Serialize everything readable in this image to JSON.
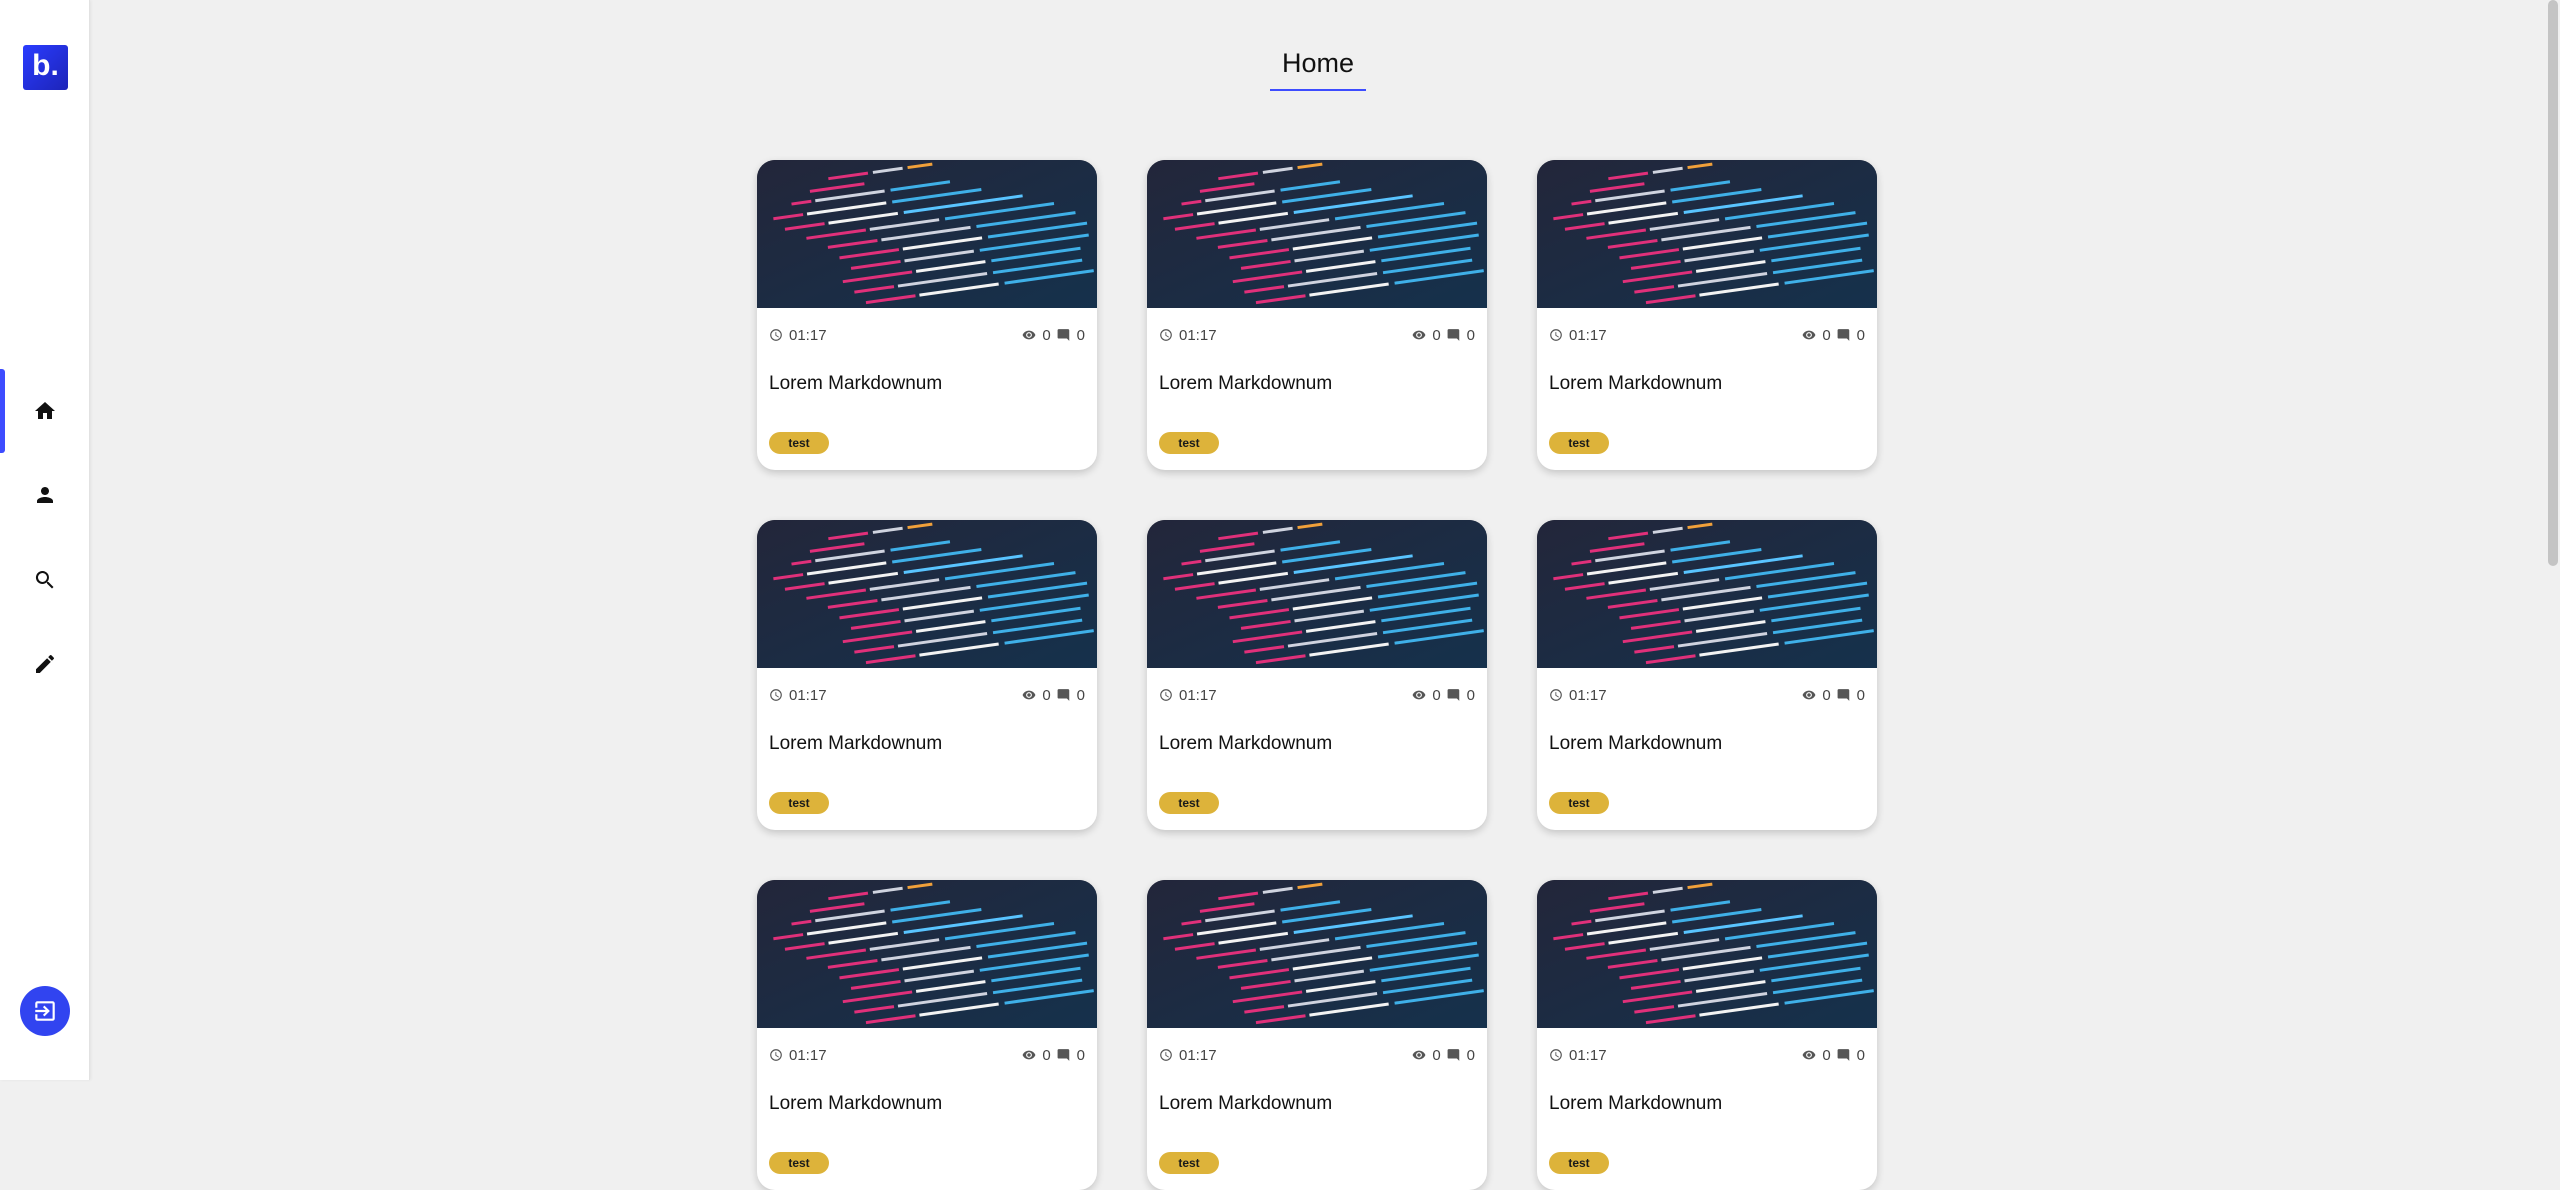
{
  "app": {
    "logo_text": "b."
  },
  "nav": {
    "items": [
      {
        "name": "home",
        "icon": "home-icon"
      },
      {
        "name": "profile",
        "icon": "person-icon"
      },
      {
        "name": "search",
        "icon": "search-icon"
      },
      {
        "name": "edit",
        "icon": "pencil-icon"
      }
    ],
    "active": "home",
    "logout_icon": "logout-icon"
  },
  "header": {
    "title": "Home"
  },
  "colors": {
    "accent": "#3d4cff",
    "tag": "#ddb33a"
  },
  "cards": [
    {
      "time": "01:17",
      "views": "0",
      "comments": "0",
      "title": "Lorem Markdownum",
      "tag": "test"
    },
    {
      "time": "01:17",
      "views": "0",
      "comments": "0",
      "title": "Lorem Markdownum",
      "tag": "test"
    },
    {
      "time": "01:17",
      "views": "0",
      "comments": "0",
      "title": "Lorem Markdownum",
      "tag": "test"
    },
    {
      "time": "01:17",
      "views": "0",
      "comments": "0",
      "title": "Lorem Markdownum",
      "tag": "test"
    },
    {
      "time": "01:17",
      "views": "0",
      "comments": "0",
      "title": "Lorem Markdownum",
      "tag": "test"
    },
    {
      "time": "01:17",
      "views": "0",
      "comments": "0",
      "title": "Lorem Markdownum",
      "tag": "test"
    },
    {
      "time": "01:17",
      "views": "0",
      "comments": "0",
      "title": "Lorem Markdownum",
      "tag": "test"
    },
    {
      "time": "01:17",
      "views": "0",
      "comments": "0",
      "title": "Lorem Markdownum",
      "tag": "test"
    },
    {
      "time": "01:17",
      "views": "0",
      "comments": "0",
      "title": "Lorem Markdownum",
      "tag": "test"
    }
  ]
}
